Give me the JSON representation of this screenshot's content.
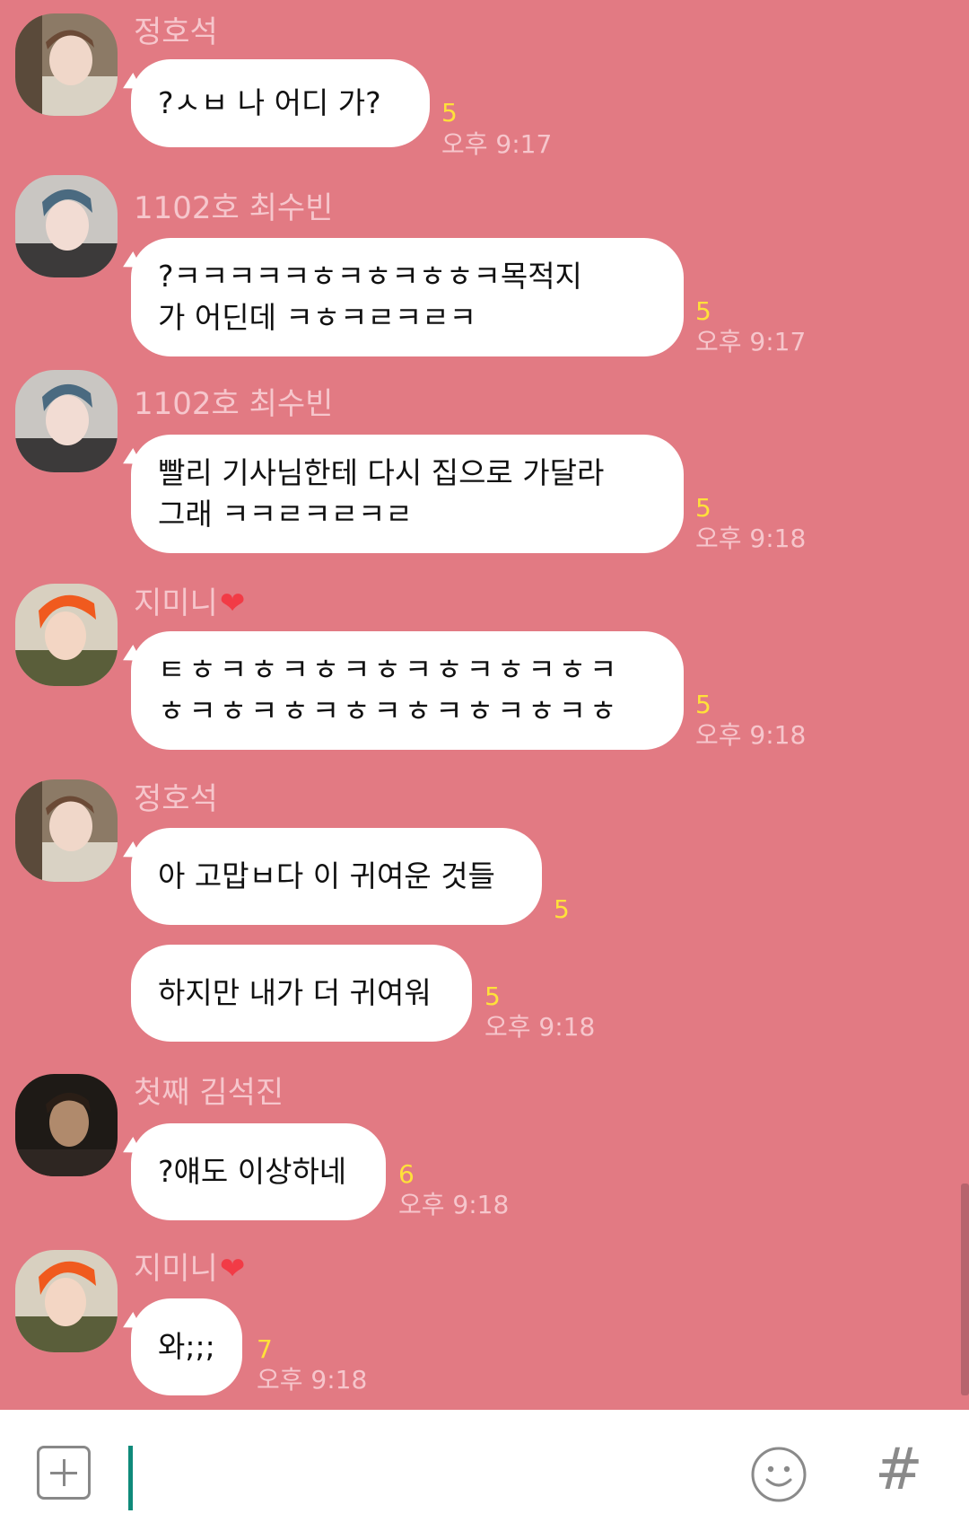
{
  "messages": [
    {
      "sender": "정호석",
      "text": [
        "?ㅅㅂ 나 어디 가?"
      ],
      "unread": "5",
      "time": "오후 9:17"
    },
    {
      "sender": "1102호 최수빈",
      "text": [
        "?ㅋㅋㅋㅋㅋㅎㅋㅎㅋㅎㅎㅋ목적지",
        "가 어딘데 ㅋㅎㅋㄹㅋㄹㅋ"
      ],
      "unread": "5",
      "time": "오후 9:17"
    },
    {
      "sender": "1102호 최수빈",
      "text": [
        "빨리 기사님한테 다시 집으로 가달라",
        "그래 ㅋㅋㄹㅋㄹㅋㄹ"
      ],
      "unread": "5",
      "time": "오후 9:18"
    },
    {
      "sender": "지미니",
      "text": [
        "ㅌㅎㅋㅎㅋㅎㅋㅎㅋㅎㅋㅎㅋㅎㅋ",
        "ㅎㅋㅎㅋㅎㅋㅎㅋㅎㅋㅎㅋㅎㅋㅎ"
      ],
      "unread": "5",
      "time": "오후 9:18"
    },
    {
      "sender": "정호석",
      "text": [
        "아 고맙ㅂ다 이 귀여운 것들"
      ],
      "unread": "5",
      "time": ""
    },
    {
      "sender": "",
      "text": [
        "하지만 내가 더 귀여워"
      ],
      "unread": "5",
      "time": "오후 9:18"
    },
    {
      "sender": "첫째 김석진",
      "text": [
        "?얘도 이상하네"
      ],
      "unread": "6",
      "time": "오후 9:18"
    },
    {
      "sender": "지미니",
      "text": [
        "와;;;"
      ],
      "unread": "7",
      "time": "오후 9:18"
    }
  ],
  "heart_icon": "heart-icon",
  "colors": {
    "background": "#e27a83",
    "sender_name": "#f6c6cc",
    "unread_count": "#ffe13a",
    "bubble": "#ffffff",
    "cursor": "#0f8a7a"
  },
  "input": {
    "attach_icon": "plus-square-icon",
    "emoji_icon": "smiley-icon",
    "hashtag_label": "#"
  }
}
